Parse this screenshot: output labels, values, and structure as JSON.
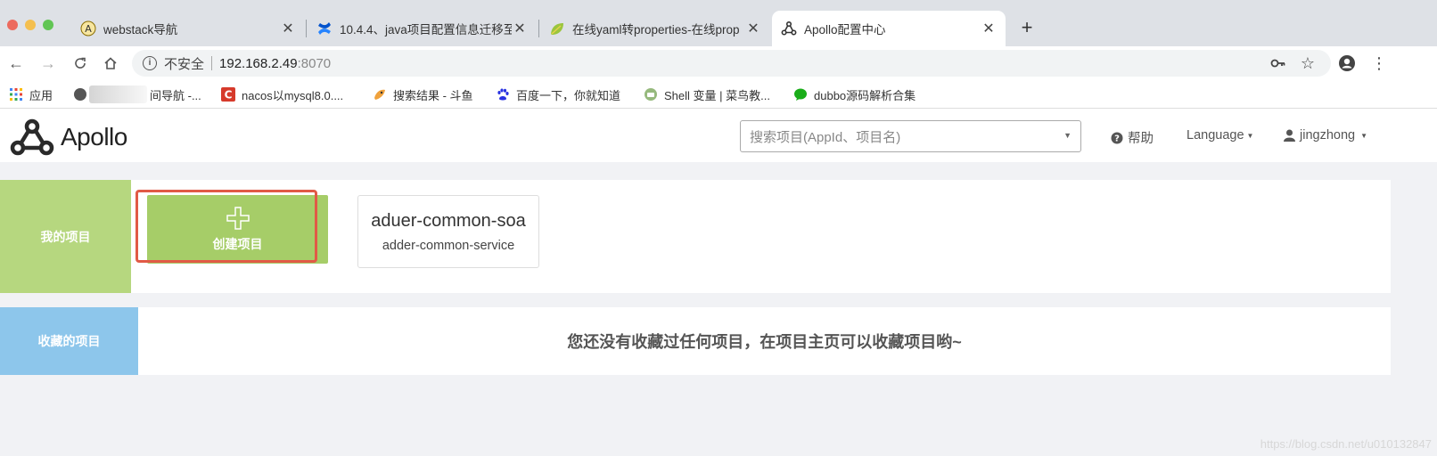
{
  "browser": {
    "tabs": [
      {
        "title": "webstack导航",
        "favicon": "a-circle-icon"
      },
      {
        "title": "10.4.4、java项目配置信息迁移至",
        "favicon": "confluence-icon"
      },
      {
        "title": "在线yaml转properties-在线prop",
        "favicon": "leaf-icon"
      },
      {
        "title": "Apollo配置中心",
        "favicon": "apollo-icon",
        "active": true
      }
    ],
    "close_glyph": "✕",
    "new_tab": "+",
    "address": {
      "security": "不安全",
      "host": "192.168.2.49",
      "port": ":8070"
    },
    "bookmarks": [
      {
        "label": "应用",
        "icon": "apps-grid-icon"
      },
      {
        "label": "间导航 -...",
        "icon": "globe-icon"
      },
      {
        "label": "nacos以mysql8.0....",
        "icon": "c-logo-icon"
      },
      {
        "label": "搜索结果 - 斗鱼",
        "icon": "douyu-icon"
      },
      {
        "label": "百度一下，你就知道",
        "icon": "baidu-paw-icon"
      },
      {
        "label": "Shell 变量 | 菜鸟教...",
        "icon": "runoob-icon"
      },
      {
        "label": "dubbo源码解析合集",
        "icon": "wechat-icon"
      }
    ]
  },
  "app": {
    "logo_text": "Apollo",
    "search_placeholder": "搜索项目(AppId、项目名)",
    "help": "帮助",
    "language": "Language",
    "user": "jingzhong"
  },
  "mine": {
    "label": "我的项目",
    "create_label": "创建项目",
    "projects": [
      {
        "app_id": "aduer-common-soa",
        "name": "adder-common-service"
      }
    ]
  },
  "favorites": {
    "label": "收藏的项目",
    "empty_message": "您还没有收藏过任何项目，在项目主页可以收藏项目哟~"
  },
  "watermark": "https://blog.csdn.net/u010132847",
  "colors": {
    "mine_label": "#b6d77f",
    "create_card": "#a6cd68",
    "fav_label": "#8dc6eb",
    "highlight": "#e15a46"
  }
}
